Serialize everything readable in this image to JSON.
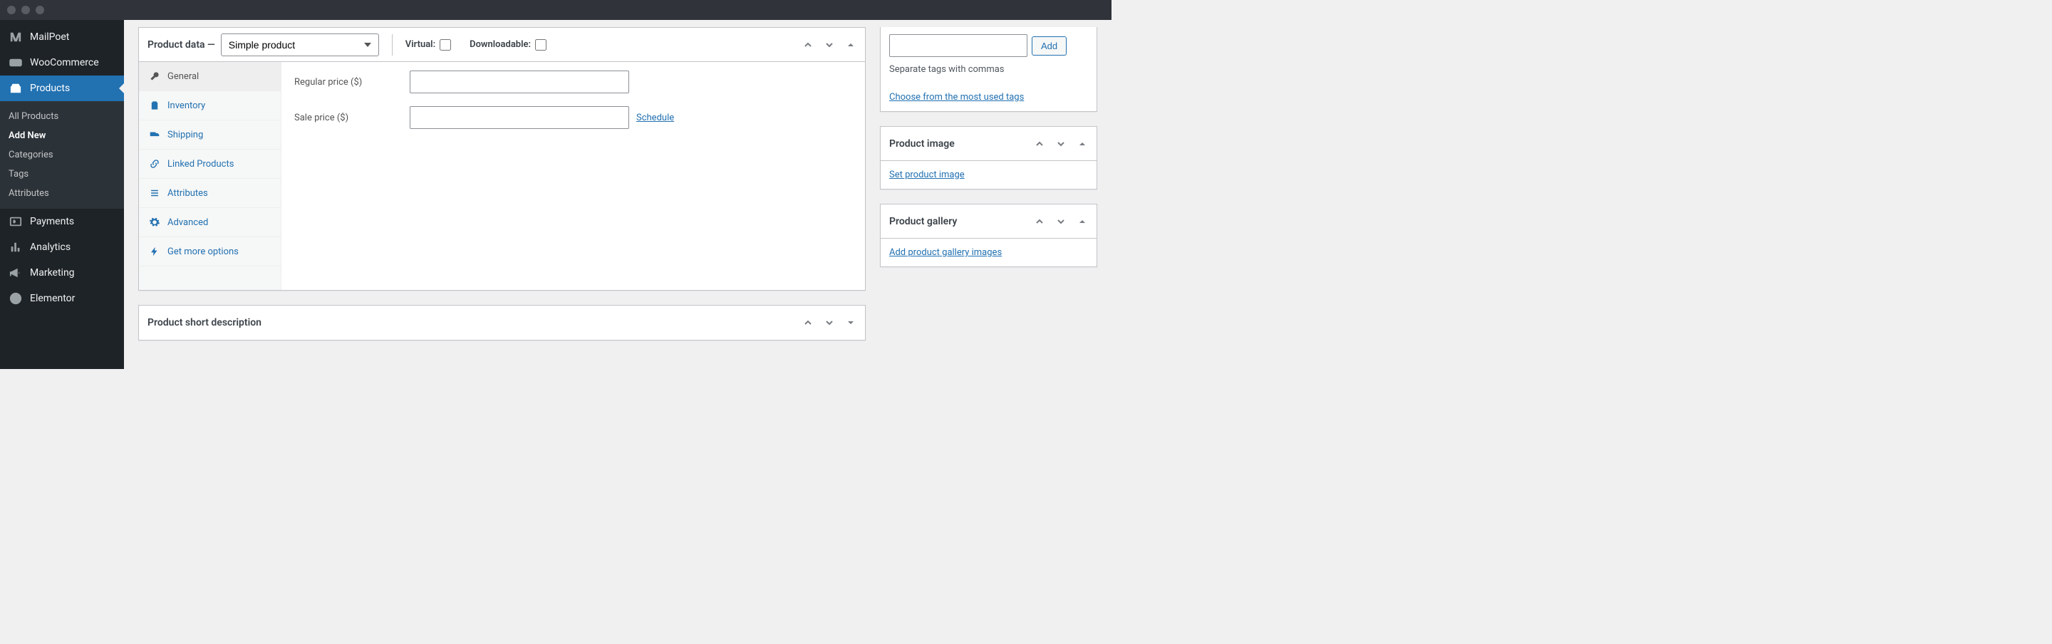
{
  "sidebar": {
    "items": [
      {
        "label": "MailPoet"
      },
      {
        "label": "WooCommerce"
      },
      {
        "label": "Products"
      },
      {
        "label": "Payments"
      },
      {
        "label": "Analytics"
      },
      {
        "label": "Marketing"
      },
      {
        "label": "Elementor"
      }
    ],
    "submenu": [
      {
        "label": "All Products"
      },
      {
        "label": "Add New"
      },
      {
        "label": "Categories"
      },
      {
        "label": "Tags"
      },
      {
        "label": "Attributes"
      }
    ]
  },
  "product_data": {
    "title_prefix": "Product data — ",
    "product_type": "Simple product",
    "virtual_label": "Virtual:",
    "downloadable_label": "Downloadable:",
    "tabs": [
      {
        "label": "General"
      },
      {
        "label": "Inventory"
      },
      {
        "label": "Shipping"
      },
      {
        "label": "Linked Products"
      },
      {
        "label": "Attributes"
      },
      {
        "label": "Advanced"
      },
      {
        "label": "Get more options"
      }
    ],
    "regular_price_label": "Regular price ($)",
    "sale_price_label": "Sale price ($)",
    "regular_price_value": "",
    "sale_price_value": "",
    "schedule_label": "Schedule"
  },
  "short_desc": {
    "title": "Product short description"
  },
  "tags_box": {
    "add_label": "Add",
    "input_value": "",
    "hint": "Separate tags with commas",
    "choose_label": "Choose from the most used tags"
  },
  "image_box": {
    "title": "Product image",
    "link": "Set product image"
  },
  "gallery_box": {
    "title": "Product gallery",
    "link": "Add product gallery images"
  }
}
